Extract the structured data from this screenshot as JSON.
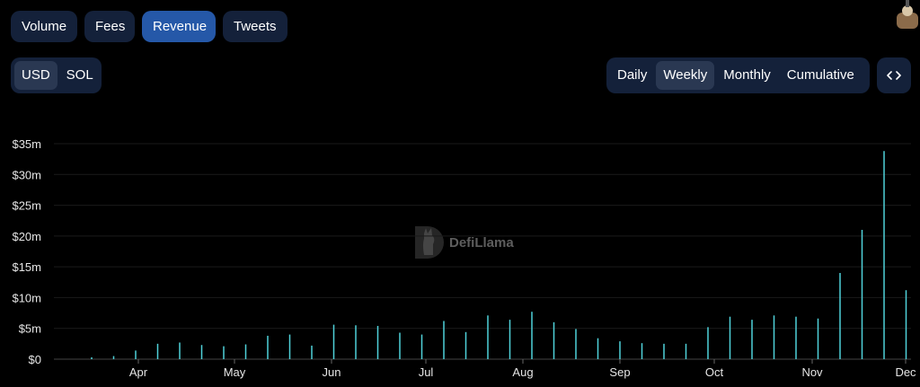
{
  "tabs": [
    {
      "label": "Volume",
      "active": false
    },
    {
      "label": "Fees",
      "active": false
    },
    {
      "label": "Revenue",
      "active": true
    },
    {
      "label": "Tweets",
      "active": false
    }
  ],
  "currency": {
    "options": [
      {
        "label": "USD",
        "active": true
      },
      {
        "label": "SOL",
        "active": false
      }
    ]
  },
  "period": {
    "options": [
      {
        "label": "Daily",
        "active": false
      },
      {
        "label": "Weekly",
        "active": true
      },
      {
        "label": "Monthly",
        "active": false
      },
      {
        "label": "Cumulative",
        "active": false
      }
    ]
  },
  "embed": {
    "icon": "code-icon"
  },
  "watermark": {
    "text": "DefiLlama"
  },
  "colors": {
    "bar": "#4fd1d9",
    "active_tab": "#2558a8",
    "pill_bg": "#14213a",
    "grid": "#1a1a1a",
    "text": "#ffffff"
  },
  "chart_data": {
    "type": "bar",
    "title": "",
    "xlabel": "",
    "ylabel": "",
    "ylim": [
      0,
      35
    ],
    "unit": "$m",
    "y_ticks": [
      "$0",
      "$5m",
      "$10m",
      "$15m",
      "$20m",
      "$25m",
      "$30m",
      "$35m"
    ],
    "x_ticks": [
      "Apr",
      "May",
      "Jun",
      "Jul",
      "Aug",
      "Sep",
      "Oct",
      "Nov",
      "Dec"
    ],
    "grid": true,
    "series": [
      {
        "values": [
          0.3,
          0.5,
          1.4,
          2.5,
          2.7,
          2.3,
          2.1,
          2.4,
          3.8,
          4.0,
          2.2,
          5.6,
          5.5,
          5.4,
          4.3,
          4.0,
          6.2,
          4.4,
          7.1,
          6.4,
          7.7,
          6.0,
          4.9,
          3.4,
          2.9,
          2.6,
          2.5,
          2.5,
          5.2,
          6.9,
          6.4,
          7.1,
          6.9,
          6.6,
          14.0,
          21.0,
          33.8,
          11.2
        ]
      }
    ]
  }
}
